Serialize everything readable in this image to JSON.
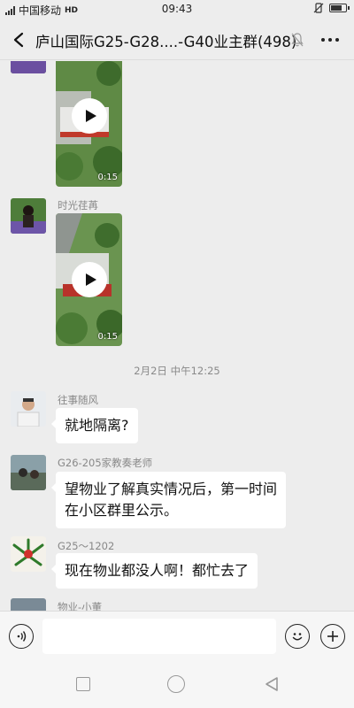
{
  "status_bar": {
    "carrier": "中国移动",
    "network": "HD",
    "time": "09:43",
    "battery_level": 0.8
  },
  "header": {
    "back_icon": "chevron-left-icon",
    "title": "庐山国际G25-G28....-G40业主群(498)",
    "mute_icon": "bell-muted-icon",
    "more_icon": "ellipsis-icon"
  },
  "messages": [
    {
      "type": "video",
      "sender": "",
      "duration": "0:15"
    },
    {
      "type": "video",
      "sender": "时光荏苒",
      "duration": "0:15"
    },
    {
      "type": "timestamp",
      "text": "2月2日 中午12:25"
    },
    {
      "type": "text",
      "sender": "往事随风",
      "text": "就地隔离?"
    },
    {
      "type": "text",
      "sender": "G26-205家教奏老师",
      "lines": [
        "望物业了解真实情况后，第一时间",
        "在小区群里公示。"
      ]
    },
    {
      "type": "text",
      "sender": "G25～1202",
      "text": "现在物业都没人啊！都忙去了"
    },
    {
      "type": "partial",
      "sender": "物业-小董"
    }
  ],
  "input_bar": {
    "voice_icon": "voice-icon",
    "placeholder": "",
    "emoji_icon": "emoji-icon",
    "plus_icon": "plus-icon"
  },
  "system_nav": {
    "recent_icon": "square-icon",
    "home_icon": "circle-icon",
    "back_icon": "triangle-back-icon"
  },
  "colors": {
    "background": "#ededed",
    "bubble": "#ffffff",
    "meta_text": "#888888"
  }
}
